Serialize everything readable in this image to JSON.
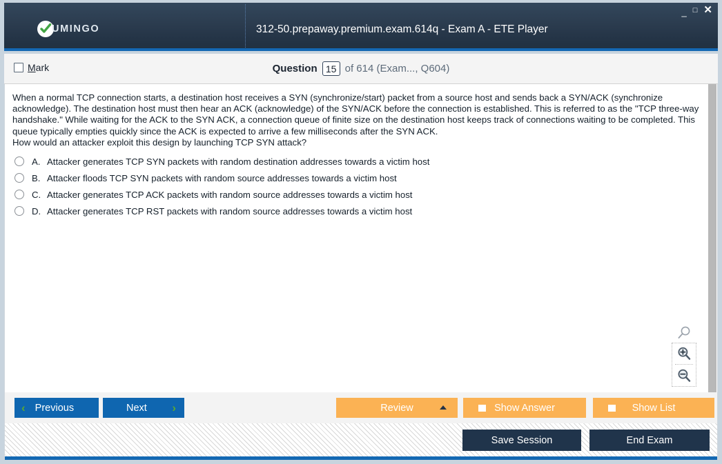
{
  "window": {
    "title": "312-50.prepaway.premium.exam.614q - Exam A - ETE Player",
    "brand": "UMINGO",
    "brand_icon": "check-circle-icon",
    "controls": {
      "minimize": "_",
      "maximize": "□",
      "close": "✕"
    },
    "accent_blue": "#1368b3",
    "header_dark": "#2c3d50"
  },
  "question_bar": {
    "mark_label_prefix": "M",
    "mark_label_rest": "ark",
    "question_word": "Question",
    "question_number": "15",
    "of_text": "of 614 (Exam..., Q604)"
  },
  "question": {
    "paragraph1": "When a normal TCP connection starts, a destination host receives a SYN (synchronize/start) packet from a source host and sends back a SYN/ACK (synchronize acknowledge). The destination host must then hear an ACK (acknowledge) of the SYN/ACK before the connection is established. This is referred to as the \"TCP three-way handshake.\" While waiting for the ACK to the SYN ACK, a connection queue of finite size on the destination host keeps track of connections waiting to be completed. This queue typically empties quickly since the ACK is expected to arrive a few milliseconds after the SYN ACK.",
    "paragraph2": "How would an attacker exploit this design by launching TCP SYN attack?",
    "options": [
      {
        "letter": "A.",
        "text": "Attacker generates TCP SYN packets with random destination addresses towards a victim host",
        "selected": false
      },
      {
        "letter": "B.",
        "text": "Attacker floods TCP SYN packets with random source addresses towards a victim host",
        "selected": false
      },
      {
        "letter": "C.",
        "text": "Attacker generates TCP ACK packets with random source addresses towards a victim host",
        "selected": false
      },
      {
        "letter": "D.",
        "text": "Attacker generates TCP RST packets with random source addresses towards a victim host",
        "selected": false
      }
    ]
  },
  "zoom_tools": {
    "reset_icon": "magnifier-icon",
    "zoom_in_icon": "magnifier-plus-icon",
    "zoom_out_icon": "magnifier-minus-icon"
  },
  "toolbar": {
    "previous_label": "Previous",
    "next_label": "Next",
    "review_label": "Review",
    "show_answer_label": "Show Answer",
    "show_list_label": "Show List",
    "chevron_left": "‹",
    "chevron_right": "›",
    "blue": "#0f66b0",
    "orange": "#fbb254"
  },
  "footer": {
    "save_session_label": "Save Session",
    "end_exam_label": "End Exam",
    "button_color": "#20344b"
  }
}
